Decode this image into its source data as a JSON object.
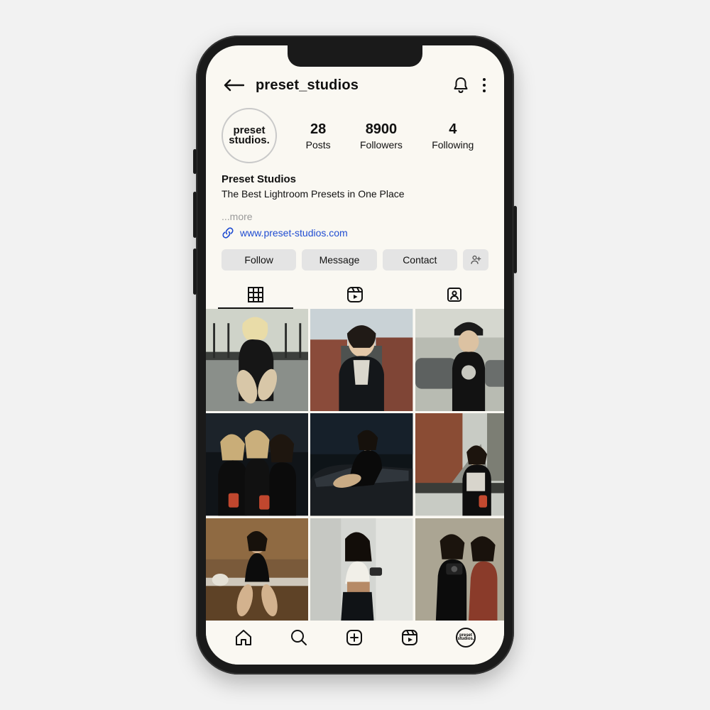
{
  "header": {
    "username": "preset_studios"
  },
  "profile": {
    "avatar_text_line1": "preset",
    "avatar_text_line2": "studios.",
    "stats": {
      "posts": {
        "num": "28",
        "label": "Posts"
      },
      "followers": {
        "num": "8900",
        "label": "Followers"
      },
      "following": {
        "num": "4",
        "label": "Following"
      }
    },
    "display_name": "Preset Studios",
    "bio_line": "The Best Lightroom Presets in One Place",
    "more": "...more",
    "link_text": "www.preset-studios.com"
  },
  "actions": {
    "follow": "Follow",
    "message": "Message",
    "contact": "Contact"
  },
  "nav_avatar_line1": "preset",
  "nav_avatar_line2": "studios."
}
